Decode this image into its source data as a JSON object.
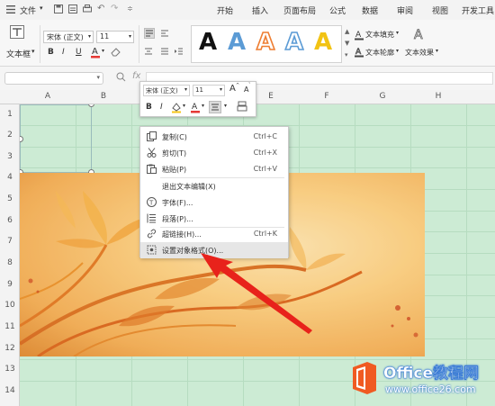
{
  "menubar": {
    "file_label": "文件",
    "tabs": [
      "开始",
      "插入",
      "页面布局",
      "公式",
      "数据",
      "审阅",
      "视图",
      "开发工具"
    ]
  },
  "ribbon": {
    "textbox_label": "文本框",
    "font_name": "宋体 (正文)",
    "font_size": "11",
    "wordart_letter": "A",
    "text_fill_label": "文本填充",
    "text_outline_label": "文本轮廓",
    "text_effect_label": "文本效果"
  },
  "formula_bar": {
    "fx_label": "fx"
  },
  "grid": {
    "columns": [
      "A",
      "B",
      "C",
      "D",
      "E",
      "F",
      "G",
      "H"
    ],
    "rows": [
      "1",
      "2",
      "3",
      "4",
      "5",
      "6",
      "7",
      "8",
      "9",
      "10",
      "11",
      "12",
      "13",
      "14"
    ]
  },
  "mini_toolbar": {
    "font_name": "宋体 (正文)",
    "font_size": "11",
    "grow_label": "A",
    "shrink_label": "A",
    "bold": "B",
    "italic": "I",
    "font_color_letter": "A"
  },
  "context_menu": {
    "items": [
      {
        "label": "复制(C)",
        "shortcut": "Ctrl+C",
        "icon": "copy-icon"
      },
      {
        "label": "剪切(T)",
        "shortcut": "Ctrl+X",
        "icon": "scissors-icon"
      },
      {
        "label": "粘贴(P)",
        "shortcut": "Ctrl+V",
        "icon": "paste-icon"
      },
      {
        "label": "退出文本编辑(X)",
        "shortcut": "",
        "icon": ""
      },
      {
        "label": "字体(F)...",
        "shortcut": "",
        "icon": "font-icon"
      },
      {
        "label": "段落(P)...",
        "shortcut": "",
        "icon": "paragraph-icon"
      },
      {
        "label": "超链接(H)...",
        "shortcut": "Ctrl+K",
        "icon": "link-icon"
      },
      {
        "label": "设置对象格式(O)...",
        "shortcut": "",
        "icon": "format-object-icon"
      }
    ]
  },
  "watermark": {
    "brand": "Office教程网",
    "url": "www.office26.com"
  },
  "colors": {
    "cell_green": "#ccebd4",
    "arrow_red": "#e8221b",
    "logo_orange": "#f05a22"
  }
}
